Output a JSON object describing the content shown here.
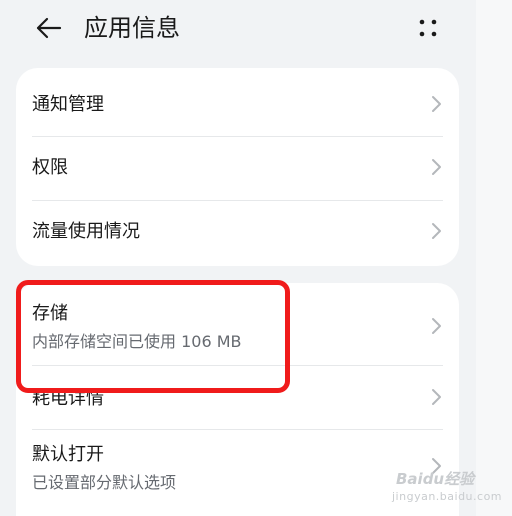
{
  "header": {
    "title": "应用信息",
    "back_icon": "back-arrow-icon",
    "more_icon": "more-dots-icon"
  },
  "group1": {
    "items": [
      {
        "label": "通知管理"
      },
      {
        "label": "权限"
      },
      {
        "label": "流量使用情况"
      }
    ]
  },
  "group2": {
    "items": [
      {
        "label": "存储",
        "sub": "内部存储空间已使用 106 MB"
      },
      {
        "label": "耗电详情"
      },
      {
        "label": "默认打开",
        "sub": "已设置部分默认选项"
      }
    ]
  },
  "annotation": {
    "color": "#f01b1b"
  },
  "watermark": {
    "line1": "Baidu经验",
    "line2": "jingyan.baidu.com"
  }
}
